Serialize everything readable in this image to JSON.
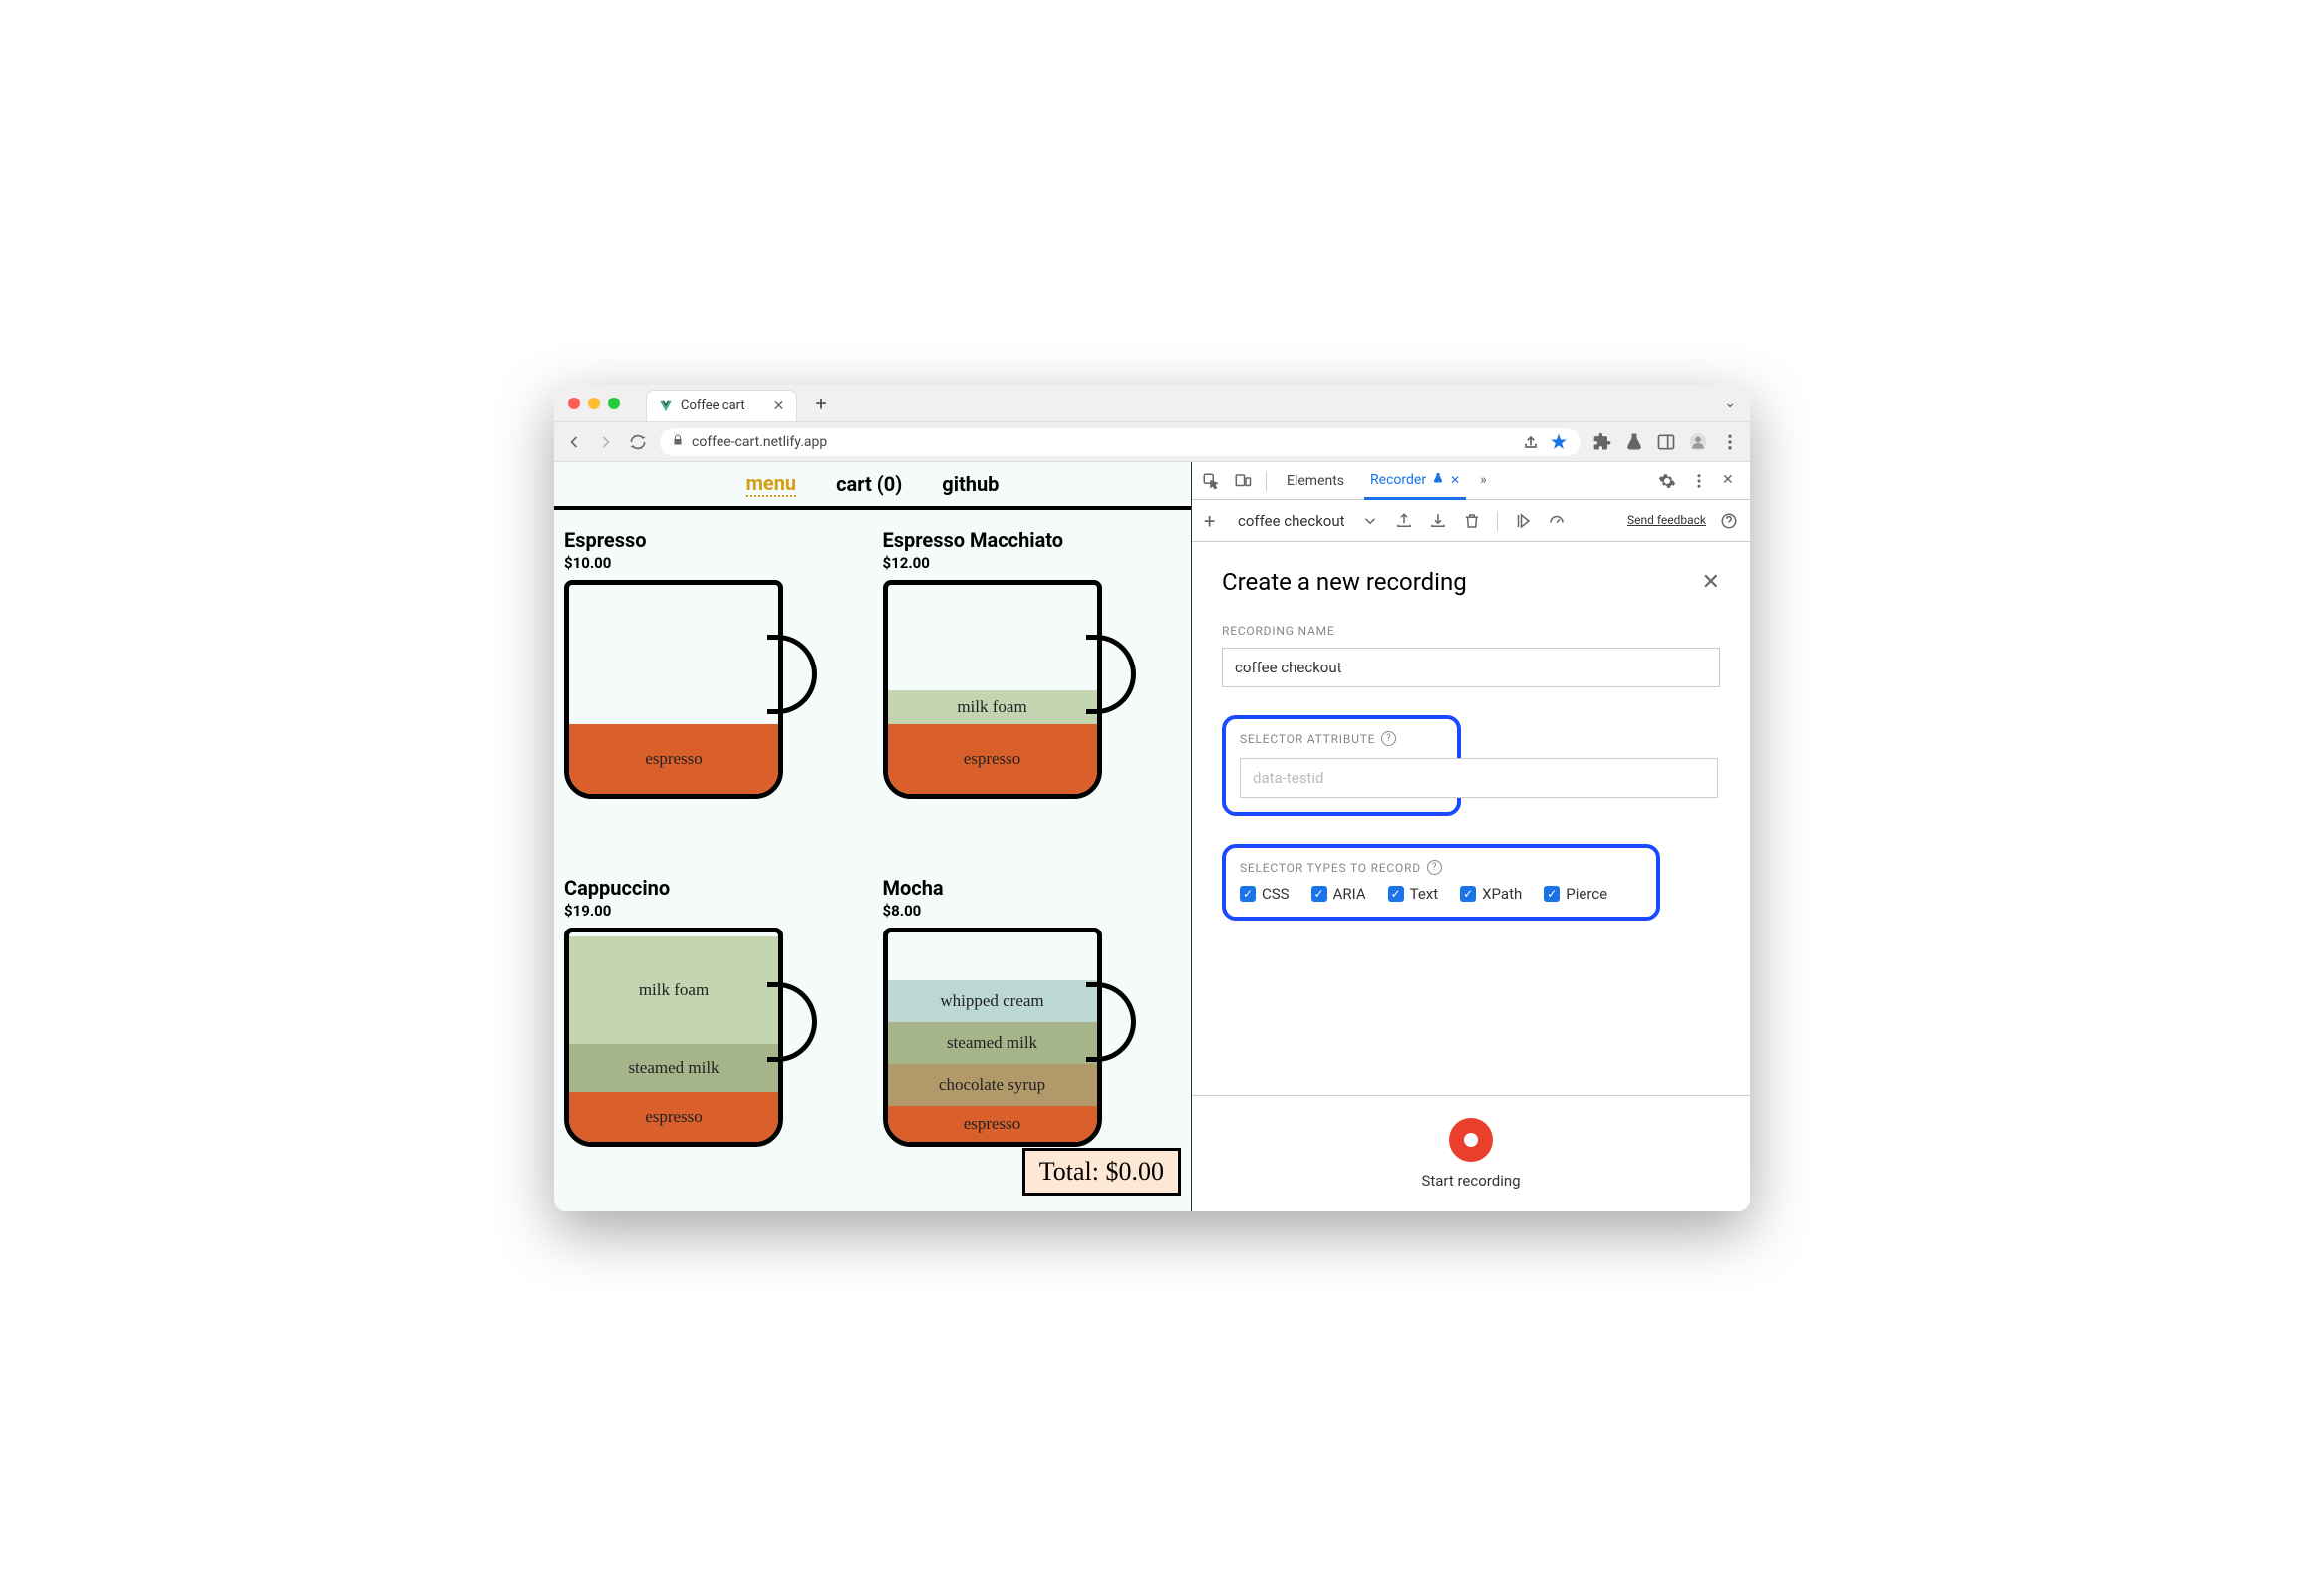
{
  "browser": {
    "tab_title": "Coffee cart",
    "url": "coffee-cart.netlify.app"
  },
  "page": {
    "nav": {
      "menu": "menu",
      "cart": "cart (0)",
      "github": "github"
    },
    "items": [
      {
        "name": "Espresso",
        "price": "$10.00",
        "layers": [
          [
            "espresso",
            "#d95f2b",
            70
          ]
        ]
      },
      {
        "name": "Espresso Macchiato",
        "price": "$12.00",
        "layers": [
          [
            "espresso",
            "#d95f2b",
            70
          ],
          [
            "milk foam",
            "#c3d4b0",
            34
          ]
        ]
      },
      {
        "name": "Cappuccino",
        "price": "$19.00",
        "layers": [
          [
            "espresso",
            "#d95f2b",
            50
          ],
          [
            "steamed milk",
            "#a6b48a",
            48
          ],
          [
            "milk foam",
            "#c3d4b0",
            108
          ]
        ]
      },
      {
        "name": "Mocha",
        "price": "$8.00",
        "layers": [
          [
            "espresso",
            "#d95f2b",
            36
          ],
          [
            "chocolate syrup",
            "#b2996a",
            42
          ],
          [
            "steamed milk",
            "#a6b48a",
            42
          ],
          [
            "whipped cream",
            "#bcd8d5",
            42
          ]
        ]
      }
    ],
    "total": "Total: $0.00"
  },
  "devtools": {
    "tabs": {
      "elements": "Elements",
      "recorder": "Recorder"
    },
    "recording_dropdown": "coffee checkout",
    "feedback": "Send feedback",
    "panel": {
      "title": "Create a new recording",
      "name_label": "RECORDING NAME",
      "name_value": "coffee checkout",
      "selector_attr_label": "SELECTOR ATTRIBUTE",
      "selector_attr_placeholder": "data-testid",
      "types_label": "SELECTOR TYPES TO RECORD",
      "types": {
        "css": "CSS",
        "aria": "ARIA",
        "text": "Text",
        "xpath": "XPath",
        "pierce": "Pierce"
      },
      "start": "Start recording"
    }
  }
}
